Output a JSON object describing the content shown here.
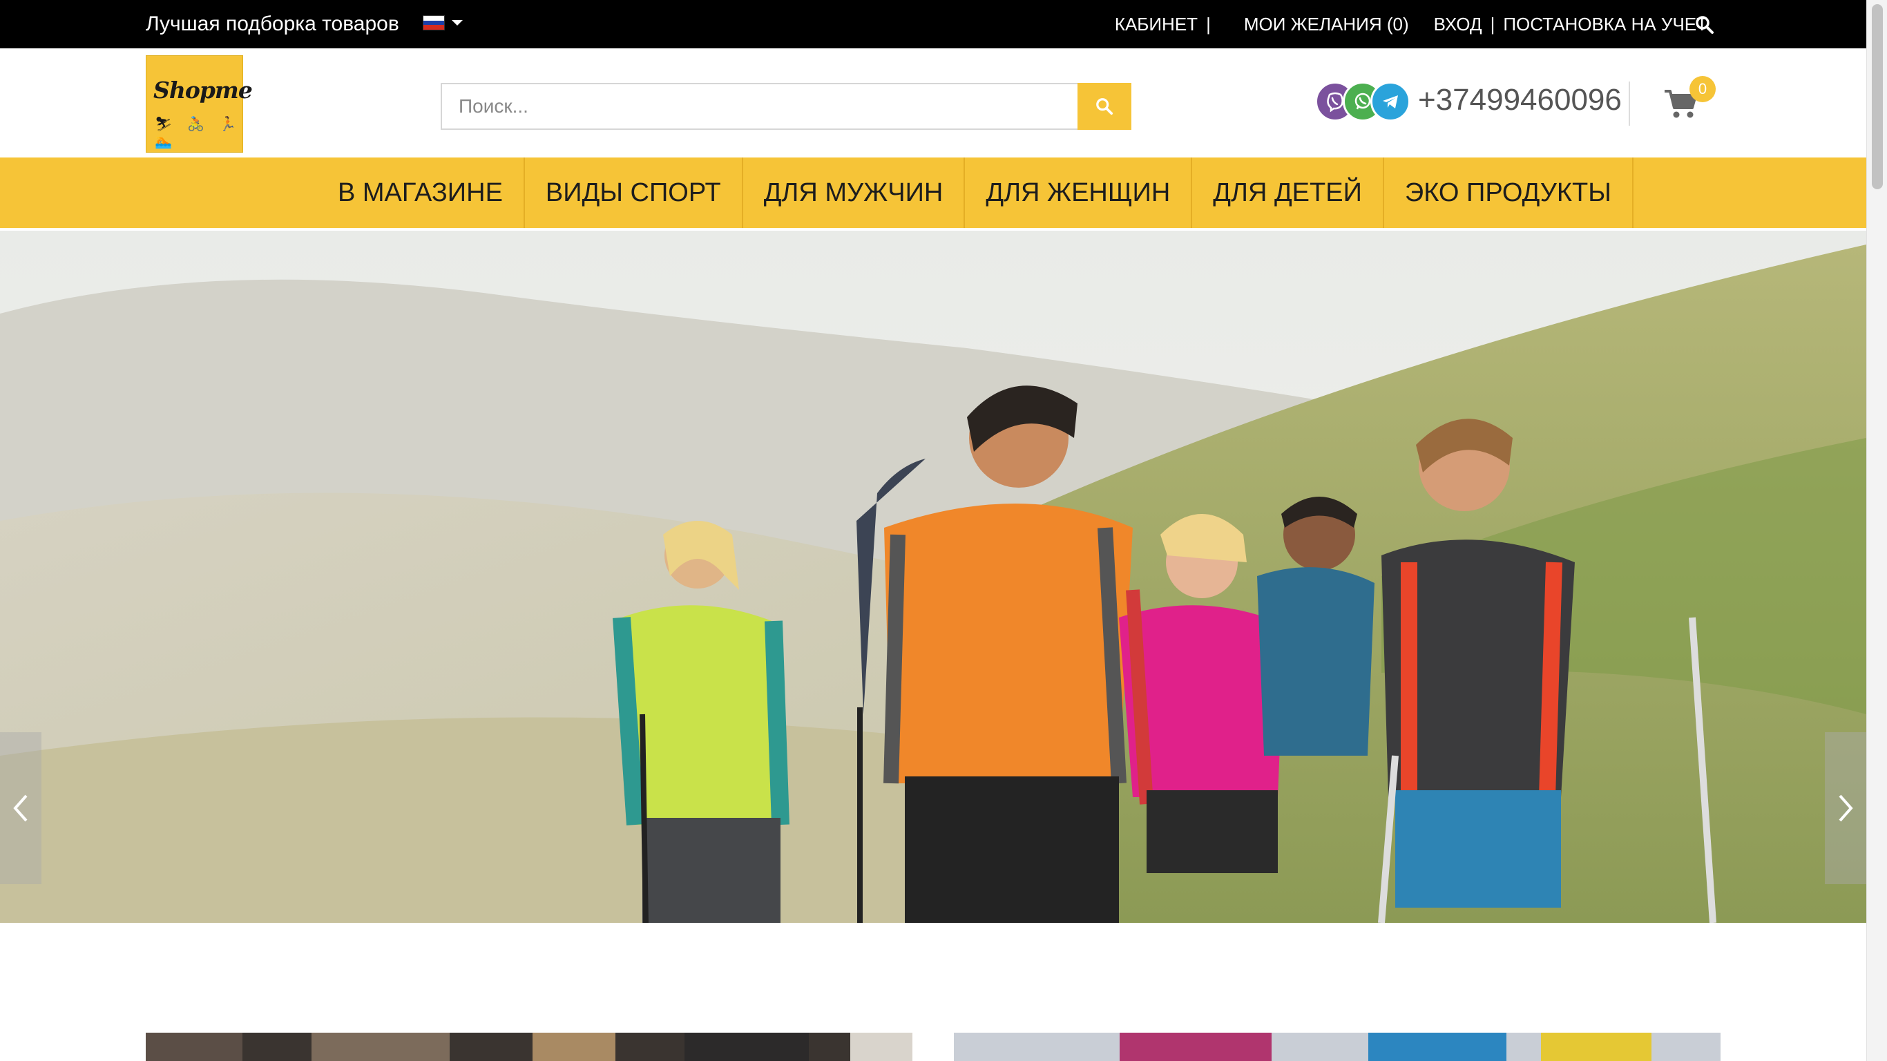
{
  "topbar": {
    "tagline": "Лучшая подборка товаров",
    "language_flag": "flag-russia",
    "links": {
      "cabinet": "КАБИНЕТ",
      "wishlist": "МОИ ЖЕЛАНИЯ (0)",
      "login": "ВХОД",
      "register": "ПОСТАНОВКА НА УЧЕТ",
      "separator": "|"
    },
    "search_icon": "search-icon"
  },
  "header": {
    "logo_text": "Shopme",
    "logo_figures": "⛷ 🚴 🏃 🏊",
    "search_placeholder": "Поиск...",
    "search_button_icon": "search-icon",
    "messengers": [
      "viber-icon",
      "whatsapp-icon",
      "telegram-icon"
    ],
    "phone": "+37499460096",
    "cart_icon": "shopping-cart-icon",
    "cart_count": "0"
  },
  "nav": {
    "items": [
      {
        "label": "В МАГАЗИНЕ"
      },
      {
        "label": "ВИДЫ СПОРТ"
      },
      {
        "label": "ДЛЯ МУЖЧИН"
      },
      {
        "label": "ДЛЯ ЖЕНЩИН"
      },
      {
        "label": "ДЛЯ ДЕТЕЙ"
      },
      {
        "label": "ЭКО ПРОДУКТЫ"
      }
    ]
  },
  "hero": {
    "image": "hikers-on-mountain-slope",
    "prev_icon": "chevron-left-icon",
    "next_icon": "chevron-right-icon"
  },
  "colors": {
    "accent": "#f6c437",
    "topbar": "#000000",
    "viber": "#7b519d",
    "whatsapp": "#4caf50",
    "telegram": "#2aa3db"
  }
}
